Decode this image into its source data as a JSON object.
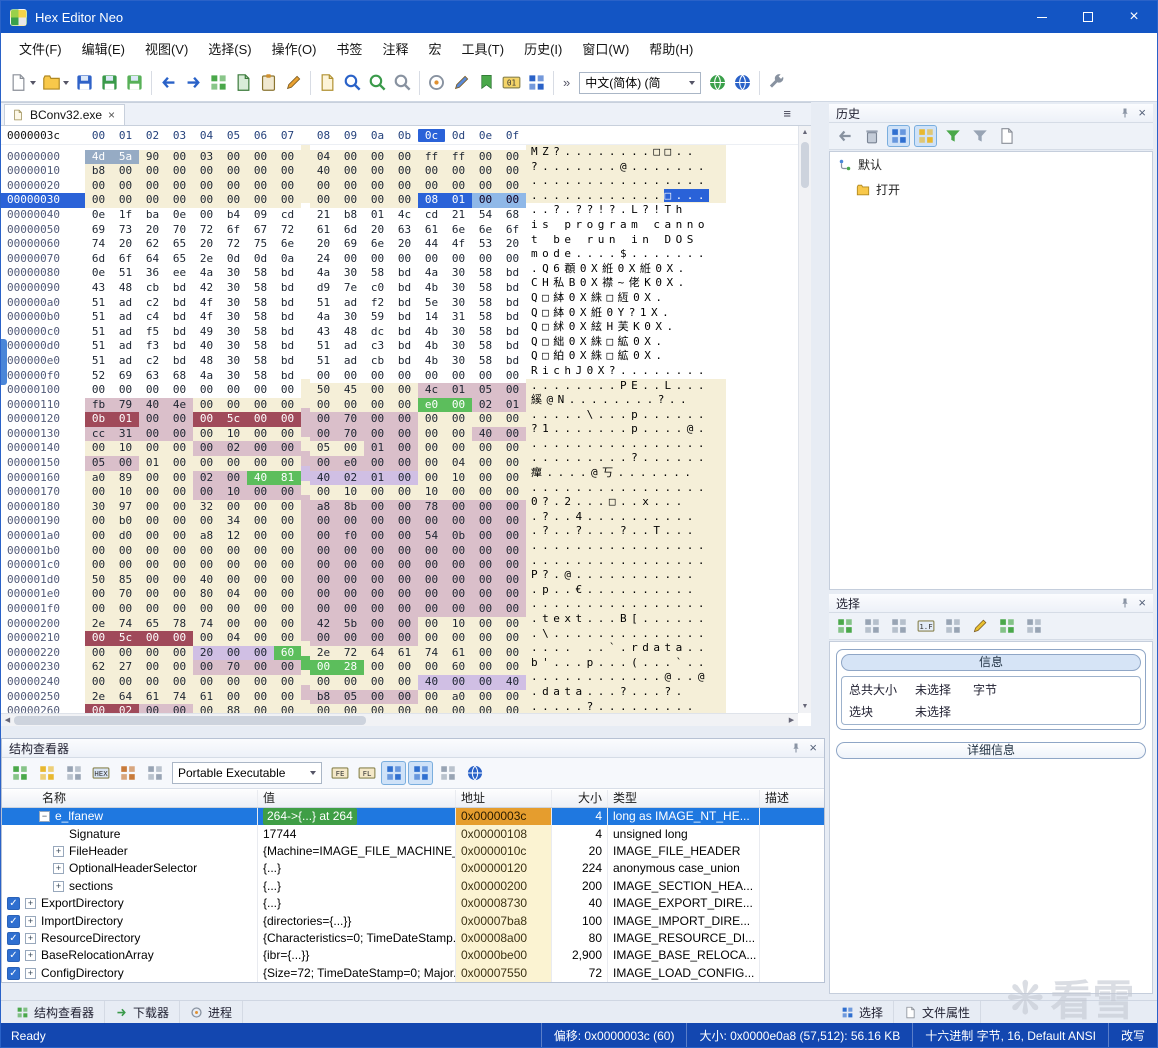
{
  "window": {
    "title": "Hex Editor Neo"
  },
  "colors": {
    "accent": "#1355c4",
    "selection": "#2a62d8",
    "statusbar": "#1347b0",
    "dos_header": "#f5efd8",
    "struct_pink": "#dabfca"
  },
  "menu": [
    "文件(F)",
    "编辑(E)",
    "视图(V)",
    "选择(S)",
    "操作(O)",
    "书签",
    "注释",
    "宏",
    "工具(T)",
    "历史(I)",
    "窗口(W)",
    "帮助(H)"
  ],
  "toolbar": {
    "language_value": "中文(简体) (简",
    "items": [
      {
        "type": "icon",
        "name": "new-file-icon",
        "caret": true
      },
      {
        "type": "icon",
        "name": "open-file-icon",
        "caret": true
      },
      {
        "type": "icon",
        "name": "save-icon"
      },
      {
        "type": "icon",
        "name": "save-as-icon"
      },
      {
        "type": "icon",
        "name": "save-all-icon"
      },
      {
        "type": "sep"
      },
      {
        "type": "icon",
        "name": "undo-icon"
      },
      {
        "type": "icon",
        "name": "redo-icon"
      },
      {
        "type": "icon",
        "name": "find-pattern-icon"
      },
      {
        "type": "icon",
        "name": "copy-icon"
      },
      {
        "type": "icon",
        "name": "paste-icon"
      },
      {
        "type": "icon",
        "name": "eraser-icon"
      },
      {
        "type": "sep"
      },
      {
        "type": "icon",
        "name": "export-icon"
      },
      {
        "type": "icon",
        "name": "find-icon"
      },
      {
        "type": "icon",
        "name": "find-next-icon"
      },
      {
        "type": "icon",
        "name": "find-prev-icon"
      },
      {
        "type": "sep"
      },
      {
        "type": "icon",
        "name": "goto-icon"
      },
      {
        "type": "icon",
        "name": "replace-icon"
      },
      {
        "type": "icon",
        "name": "bookmark-icon"
      },
      {
        "type": "icon",
        "name": "binary-01-icon"
      },
      {
        "type": "icon",
        "name": "structure-grid-icon"
      },
      {
        "type": "sep"
      },
      {
        "type": "chevron",
        "label": "»"
      },
      {
        "type": "combo"
      },
      {
        "type": "icon",
        "name": "globe-green-icon"
      },
      {
        "type": "icon",
        "name": "globe-blue-icon"
      },
      {
        "type": "sep"
      },
      {
        "type": "icon",
        "name": "wrench-icon"
      }
    ]
  },
  "tab": {
    "label": "BConv32.exe"
  },
  "hex": {
    "corner": "0000003c",
    "columns": [
      "00",
      "01",
      "02",
      "03",
      "04",
      "05",
      "06",
      "07",
      "08",
      "09",
      "0a",
      "0b",
      "0c",
      "0d",
      "0e",
      "0f"
    ],
    "selected_column_index": 12,
    "rows": [
      {
        "a": "00000000",
        "b": "4d 5a 90 00 03 00 00 00 04 00 00 00 ff ff 00 00",
        "c": "ssyyyyyyyyyyyyyy",
        "t": "MZ?........□□..",
        "g": "y"
      },
      {
        "a": "00000010",
        "b": "b8 00 00 00 00 00 00 00 40 00 00 00 00 00 00 00",
        "c": "yyyyyyyyyyyyyyyy",
        "t": "?.......@.......",
        "g": "y"
      },
      {
        "a": "00000020",
        "b": "00 00 00 00 00 00 00 00 00 00 00 00 00 00 00 00",
        "c": "yyyyyyyyyyyyyyyy",
        "t": "................",
        "g": "y"
      },
      {
        "a": "00000030",
        "b": "00 00 00 00 00 00 00 00 00 00 00 00 08 01 00 00",
        "c": "yyyyyyyyyyyybbll",
        "t": "............□...",
        "g": "y",
        "cur": true,
        "sf": 12
      },
      {
        "a": "00000040",
        "b": "0e 1f ba 0e 00 b4 09 cd 21 b8 01 4c cd 21 54 68",
        "c": "wwwwwwwwwwwwwwww",
        "t": "..?.??!?.L?!Th",
        "g": "w"
      },
      {
        "a": "00000050",
        "b": "69 73 20 70 72 6f 67 72 61 6d 20 63 61 6e 6e 6f",
        "c": "wwwwwwwwwwwwwwww",
        "t": "is program canno",
        "g": "w"
      },
      {
        "a": "00000060",
        "b": "74 20 62 65 20 72 75 6e 20 69 6e 20 44 4f 53 20",
        "c": "wwwwwwwwwwwwwwww",
        "t": "t be run in DOS ",
        "g": "w"
      },
      {
        "a": "00000070",
        "b": "6d 6f 64 65 2e 0d 0d 0a 24 00 00 00 00 00 00 00",
        "c": "wwwwwwwwwwwwwwww",
        "t": "mode....$.......",
        "g": "w"
      },
      {
        "a": "00000080",
        "b": "0e 51 36 ee 4a 30 58 bd 4a 30 58 bd 4a 30 58 bd",
        "c": "wwwwwwwwwwwwwwww",
        "t": ".Q6頵0X絍0X絍0X.",
        "g": "w"
      },
      {
        "a": "00000090",
        "b": "43 48 cb bd 42 30 58 bd d9 7e c0 bd 4b 30 58 bd",
        "c": "wwwwwwwwwwwwwwww",
        "t": "CH私B0X襟~佬K0X.",
        "g": "w"
      },
      {
        "a": "000000a0",
        "b": "51 ad c2 bd 4f 30 58 bd 51 ad f2 bd 5e 30 58 bd",
        "c": "wwwwwwwwwwwwwwww",
        "t": "Q□絊0X絑□絚0X.",
        "g": "w"
      },
      {
        "a": "000000b0",
        "b": "51 ad c4 bd 4f 30 58 bd 4a 30 59 bd 14 31 58 bd",
        "c": "wwwwwwwwwwwwwwww",
        "t": "Q□絊0X絍0Y?1X.",
        "g": "w"
      },
      {
        "a": "000000c0",
        "b": "51 ad f5 bd 49 30 58 bd 43 48 dc bd 4b 30 58 bd",
        "c": "wwwwwwwwwwwwwwww",
        "t": "Q□絉0X絃H芙K0X.",
        "g": "w"
      },
      {
        "a": "000000d0",
        "b": "51 ad f3 bd 40 30 58 bd 51 ad c3 bd 4b 30 58 bd",
        "c": "wwwwwwwwwwwwwwww",
        "t": "Q□絀0X絑□絋0X.",
        "g": "w"
      },
      {
        "a": "000000e0",
        "b": "51 ad c2 bd 48 30 58 bd 51 ad cb bd 4b 30 58 bd",
        "c": "wwwwwwwwwwwwwwww",
        "t": "Q□絈0X絑□絋0X.",
        "g": "w"
      },
      {
        "a": "000000f0",
        "b": "52 69 63 68 4a 30 58 bd 00 00 00 00 00 00 00 00",
        "c": "wwwwwwwwwwwwwwww",
        "t": "RichJ0X?........",
        "g": "w"
      },
      {
        "a": "00000100",
        "b": "00 00 00 00 00 00 00 00 50 45 00 00 4c 01 05 00",
        "c": "wwwwwwwwyyyypppp",
        "t": "........PE..L...",
        "g": "y"
      },
      {
        "a": "00000110",
        "b": "fb 79 40 4e 00 00 00 00 00 00 00 00 e0 00 02 01",
        "c": "ppppyyyyyyyyGGpp",
        "t": "縘@N........?..",
        "g": "y"
      },
      {
        "a": "00000120",
        "b": "0b 01 00 00 00 5c 00 00 00 70 00 00 00 00 00 00",
        "c": "mmppmmmmppppyyyy",
        "t": ".....\\...p......",
        "g": "y"
      },
      {
        "a": "00000130",
        "b": "cc 31 00 00 00 10 00 00 00 70 00 00 00 00 40 00",
        "c": "ppppyyyyppppyypp",
        "t": "?1.......p....@.",
        "g": "y"
      },
      {
        "a": "00000140",
        "b": "00 10 00 00 00 02 00 00 05 00 01 00 00 00 00 00",
        "c": "yyyyppppyyppyyyy",
        "t": "................",
        "g": "y"
      },
      {
        "a": "00000150",
        "b": "05 00 01 00 00 00 00 00 00 e0 00 00 00 04 00 00",
        "c": "ppyyyyyyppppyyyy",
        "t": ".........?......",
        "g": "y"
      },
      {
        "a": "00000160",
        "b": "a0 89 00 00 02 00 40 81 40 02 01 00 00 10 00 00",
        "c": "yyyyppGGvvvvyyyy",
        "t": "癉....@丂.......",
        "g": "y"
      },
      {
        "a": "00000170",
        "b": "00 10 00 00 00 10 00 00 00 10 00 00 10 00 00 00",
        "c": "yyyyppppyyyyyyyy",
        "t": "................",
        "g": "y"
      },
      {
        "a": "00000180",
        "b": "30 97 00 00 32 00 00 00 a8 8b 00 00 78 00 00 00",
        "c": "yyyyyyyypppppppp",
        "t": "0?.2...□..x...",
        "g": "y"
      },
      {
        "a": "00000190",
        "b": "00 b0 00 00 00 34 00 00 00 00 00 00 00 00 00 00",
        "c": "yyyyyyyypppppppp",
        "t": ".?..4..........",
        "g": "y"
      },
      {
        "a": "000001a0",
        "b": "00 d0 00 00 a8 12 00 00 00 f0 00 00 54 0b 00 00",
        "c": "yyyyyyyypppppppp",
        "t": ".?..?...?..T...",
        "g": "y"
      },
      {
        "a": "000001b0",
        "b": "00 00 00 00 00 00 00 00 00 00 00 00 00 00 00 00",
        "c": "yyyyyyyypppppppp",
        "t": "................",
        "g": "y"
      },
      {
        "a": "000001c0",
        "b": "00 00 00 00 00 00 00 00 00 00 00 00 00 00 00 00",
        "c": "yyyyyyyypppppppp",
        "t": "................",
        "g": "y"
      },
      {
        "a": "000001d0",
        "b": "50 85 00 00 40 00 00 00 00 00 00 00 00 00 00 00",
        "c": "yyyyyyyypppppppp",
        "t": "P?.@...........",
        "g": "y"
      },
      {
        "a": "000001e0",
        "b": "00 70 00 00 80 04 00 00 00 00 00 00 00 00 00 00",
        "c": "yyyyyyyypppppppp",
        "t": ".p..€..........",
        "g": "y"
      },
      {
        "a": "000001f0",
        "b": "00 00 00 00 00 00 00 00 00 00 00 00 00 00 00 00",
        "c": "yyyyyyyypppppppp",
        "t": "................",
        "g": "y"
      },
      {
        "a": "00000200",
        "b": "2e 74 65 78 74 00 00 00 42 5b 00 00 00 10 00 00",
        "c": "yyyyyyyyppppyyyy",
        "t": ".text...B[......",
        "g": "y"
      },
      {
        "a": "00000210",
        "b": "00 5c 00 00 00 04 00 00 00 00 00 00 00 00 00 00",
        "c": "mmmmyyyyppppyyyy",
        "t": ".\\..............",
        "g": "y"
      },
      {
        "a": "00000220",
        "b": "00 00 00 00 20 00 00 60 2e 72 64 61 74 61 00 00",
        "c": "yyyyvvvGyyyyyyyy",
        "t": ".... ..`.rdata..",
        "g": "y"
      },
      {
        "a": "00000230",
        "b": "62 27 00 00 00 70 00 00 00 28 00 00 00 60 00 00",
        "c": "yyyyppppGGyyyyyy",
        "t": "b'...p...(...`..",
        "g": "y"
      },
      {
        "a": "00000240",
        "b": "00 00 00 00 00 00 00 00 00 00 00 00 40 00 00 40",
        "c": "yyyyyyyyyyyyvvvv",
        "t": "............@..@",
        "g": "y"
      },
      {
        "a": "00000250",
        "b": "2e 64 61 74 61 00 00 00 b8 05 00 00 00 a0 00 00",
        "c": "yyyyyyyyppppyyyy",
        "t": ".data...?...?.",
        "g": "y"
      },
      {
        "a": "00000260",
        "b": "00 02 00 00 00 88 00 00 00 00 00 00 00 00 00 00",
        "c": "mmppyyyyyyyyyyyy",
        "t": ".....?.........",
        "g": "y"
      }
    ]
  },
  "history": {
    "title": "历史",
    "toolbar": [
      "clear-history-icon",
      "delete-history-icon",
      "history-tree-view-icon",
      "history-branch-view-icon",
      "filter-apply-icon",
      "filter-clear-icon",
      "history-note-icon"
    ],
    "toolbar_active": [
      2,
      3
    ],
    "items": [
      {
        "label": "默认",
        "level": 0,
        "icon": "branch-icon"
      },
      {
        "label": "打开",
        "level": 1,
        "icon": "open-folder-icon"
      }
    ]
  },
  "selection": {
    "title": "选择",
    "toolbar": [
      "sel-block-icon",
      "sel-rows-icon",
      "sel-cols-icon",
      "sel-1f-icon",
      "sel-range-icon",
      "hand-icon",
      "sel-add-icon",
      "sel-more-icon"
    ],
    "info_title": "信息",
    "total_label": "总共大小",
    "total_value": "未选择",
    "unit_label": "字节",
    "block_label": "选块",
    "block_value": "未选择",
    "details_label": "详细信息"
  },
  "structure": {
    "title": "结构查看器",
    "format_value": "Portable Executable",
    "toolbar_pre": [
      "bind-structure-icon",
      "add-structure-icon",
      "remove-structure-icon",
      "hex-view-icon",
      "grid-a-icon",
      "grid-b-icon"
    ],
    "toolbar_post": [
      "attach-icon",
      "navigate-icon",
      "sync-cursor-icon",
      "sync-selection-icon",
      "expand-all-icon",
      "scheme-icon"
    ],
    "toolbar_post_active": [
      2,
      3
    ],
    "columns": [
      "名称",
      "值",
      "地址",
      "大小",
      "类型",
      "描述"
    ],
    "rows": [
      {
        "n": "e_lfanew",
        "v": "264->{...} at 264",
        "ad": "0x0000003c",
        "sz": "4",
        "ty": "long as IMAGE_NT_HE...",
        "lv": 1,
        "ex": "minus",
        "ck": null,
        "sel": true
      },
      {
        "n": "Signature",
        "v": "17744",
        "ad": "0x00000108",
        "sz": "4",
        "ty": "unsigned long",
        "lv": 2,
        "ex": "none",
        "ck": null
      },
      {
        "n": "FileHeader",
        "v": "{Machine=IMAGE_FILE_MACHINE_I...",
        "ad": "0x0000010c",
        "sz": "20",
        "ty": "IMAGE_FILE_HEADER",
        "lv": 2,
        "ex": "plus",
        "ck": null
      },
      {
        "n": "OptionalHeaderSelector",
        "v": "{...}",
        "ad": "0x00000120",
        "sz": "224",
        "ty": "anonymous case_union",
        "lv": 2,
        "ex": "plus",
        "ck": null
      },
      {
        "n": "sections",
        "v": "{...}",
        "ad": "0x00000200",
        "sz": "200",
        "ty": "IMAGE_SECTION_HEA...",
        "lv": 2,
        "ex": "plus",
        "ck": null
      },
      {
        "n": "ExportDirectory",
        "v": "{...}",
        "ad": "0x00008730",
        "sz": "40",
        "ty": "IMAGE_EXPORT_DIRE...",
        "lv": 0,
        "ex": "plus",
        "ck": true
      },
      {
        "n": "ImportDirectory",
        "v": "{directories={...}}",
        "ad": "0x00007ba8",
        "sz": "100",
        "ty": "IMAGE_IMPORT_DIRE...",
        "lv": 0,
        "ex": "plus",
        "ck": true
      },
      {
        "n": "ResourceDirectory",
        "v": "{Characteristics=0; TimeDateStamp...",
        "ad": "0x00008a00",
        "sz": "80",
        "ty": "IMAGE_RESOURCE_DI...",
        "lv": 0,
        "ex": "plus",
        "ck": true
      },
      {
        "n": "BaseRelocationArray",
        "v": "{ibr={...}}",
        "ad": "0x0000be00",
        "sz": "2,900",
        "ty": "IMAGE_BASE_RELOCA...",
        "lv": 0,
        "ex": "plus",
        "ck": true
      },
      {
        "n": "ConfigDirectory",
        "v": "{Size=72; TimeDateStamp=0; Major...",
        "ad": "0x00007550",
        "sz": "72",
        "ty": "IMAGE_LOAD_CONFIG...",
        "lv": 0,
        "ex": "plus",
        "ck": true
      }
    ]
  },
  "bottom_tabs": {
    "left": [
      {
        "label": "结构查看器",
        "icon": "struct-tab-icon"
      },
      {
        "label": "下载器",
        "icon": "downloader-tab-icon"
      },
      {
        "label": "进程",
        "icon": "process-tab-icon"
      }
    ],
    "right": [
      {
        "label": "选择",
        "icon": "selection-tab-icon"
      },
      {
        "label": "文件属性",
        "icon": "file-props-tab-icon"
      }
    ]
  },
  "status": {
    "left": "Ready",
    "segments": [
      "偏移: 0x0000003c (60)",
      "大小: 0x0000e0a8 (57,512): 56.16 KB",
      "十六进制 字节, 16, Default ANSI",
      "改写"
    ]
  },
  "watermark": {
    "logo": "❋",
    "text": "看雪"
  }
}
